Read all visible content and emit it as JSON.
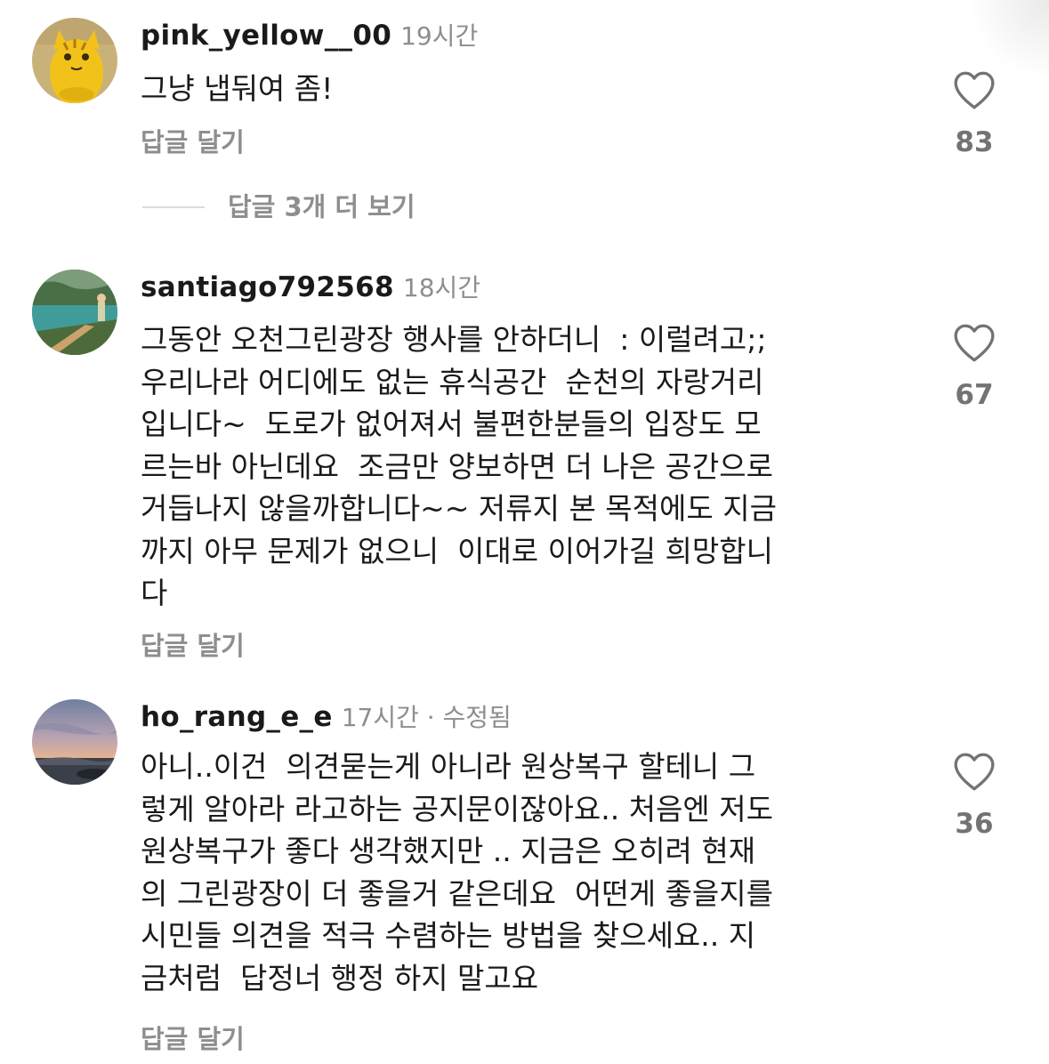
{
  "comments": [
    {
      "username": "pink_yellow__00",
      "time": "19시간",
      "text": "그냥 냅둬여 좀!",
      "reply_label": "답글 달기",
      "likes": "83",
      "view_replies": "답글 3개 더 보기"
    },
    {
      "username": "santiago792568",
      "time": "18시간",
      "text": "그동안 오천그린광장 행사를 안하더니  : 이럴려고;;\n우리나라 어디에도 없는 휴식공간  순천의 자랑거리\n입니다~  도로가 없어져서 불편한분들의 입장도 모\n르는바 아닌데요  조금만 양보하면 더 나은 공간으로\n거듭나지 않을까합니다~~ 저류지 본 목적에도 지금\n까지 아무 문제가 없으니  이대로 이어가길 희망합니\n다",
      "reply_label": "답글 달기",
      "likes": "67"
    },
    {
      "username": "ho_rang_e_e",
      "time": "17시간 · 수정됨",
      "text": "아니..이건  의견묻는게 아니라 원상복구 할테니 그\n렇게 알아라 라고하는 공지문이잖아요.. 처음엔 저도\n원상복구가 좋다 생각했지만 .. 지금은 오히려 현재\n의 그린광장이 더 좋을거 같은데요  어떤게 좋을지를\n시민들 의견을 적극 수렴하는 방법을 찾으세요.. 지\n금처럼  답정너 행정 하지 말고요",
      "reply_label": "답글 달기",
      "likes": "36"
    }
  ],
  "icons": {
    "like": "heart-outline-icon",
    "avatar_1": "cat-figurine-avatar",
    "avatar_2": "boardwalk-photo-avatar",
    "avatar_3": "sunset-photo-avatar"
  },
  "colors": {
    "text": "#1a1a1a",
    "muted": "#8e8e8e",
    "count": "#737373",
    "divider": "#dbdbdb"
  }
}
